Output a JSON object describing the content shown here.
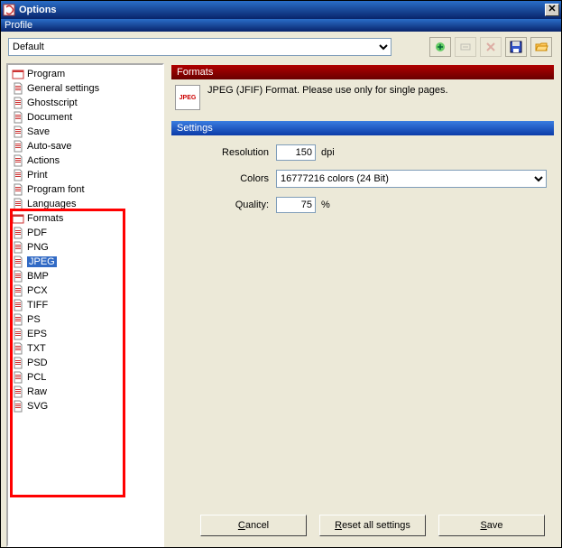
{
  "window": {
    "title": "Options"
  },
  "profile": {
    "label": "Profile",
    "selected": "Default"
  },
  "toolbar": {
    "buttons": [
      {
        "name": "profile-add",
        "disabled": false
      },
      {
        "name": "profile-rename",
        "disabled": true
      },
      {
        "name": "profile-delete",
        "disabled": true
      },
      {
        "name": "profile-save",
        "disabled": false
      },
      {
        "name": "profile-open",
        "disabled": false
      }
    ]
  },
  "tree": {
    "nodes": [
      {
        "label": "Program",
        "children": [
          {
            "label": "General settings"
          },
          {
            "label": "Ghostscript"
          },
          {
            "label": "Document"
          },
          {
            "label": "Save"
          },
          {
            "label": "Auto-save"
          },
          {
            "label": "Actions"
          },
          {
            "label": "Print"
          },
          {
            "label": "Program font"
          },
          {
            "label": "Languages"
          }
        ]
      },
      {
        "label": "Formats",
        "children": [
          {
            "label": "PDF"
          },
          {
            "label": "PNG"
          },
          {
            "label": "JPEG",
            "selected": true
          },
          {
            "label": "BMP"
          },
          {
            "label": "PCX"
          },
          {
            "label": "TIFF"
          },
          {
            "label": "PS"
          },
          {
            "label": "EPS"
          },
          {
            "label": "TXT"
          },
          {
            "label": "PSD"
          },
          {
            "label": "PCL"
          },
          {
            "label": "Raw"
          },
          {
            "label": "SVG"
          }
        ]
      }
    ]
  },
  "formats_section": {
    "header": "Formats",
    "icon_text": "JPEG",
    "description": "JPEG (JFIF) Format. Please use only for single pages."
  },
  "settings_section": {
    "header": "Settings",
    "resolution": {
      "label": "Resolution",
      "value": "150",
      "unit": "dpi"
    },
    "colors": {
      "label": "Colors",
      "selected": "16777216 colors (24 Bit)"
    },
    "quality": {
      "label": "Quality:",
      "value": "75",
      "unit": "%"
    }
  },
  "footer": {
    "cancel": "Cancel",
    "reset": "Reset all settings",
    "save": "Save"
  }
}
